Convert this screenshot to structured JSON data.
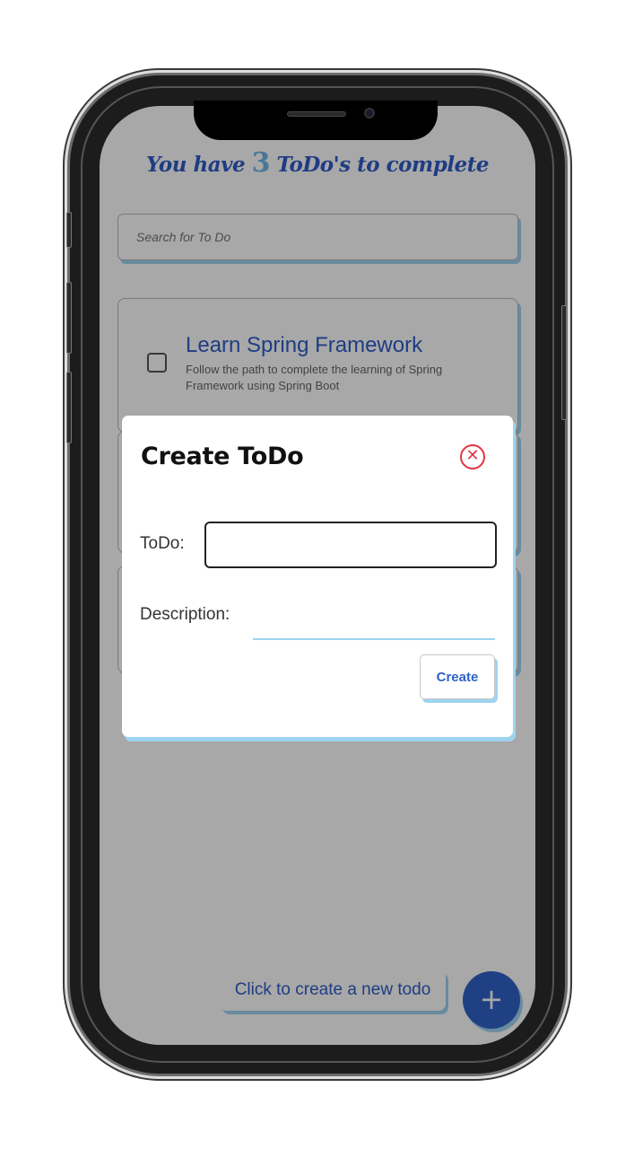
{
  "app": {
    "title_prefix": "You have ",
    "todo_count": "3",
    "title_suffix": " ToDo's to complete",
    "search_placeholder": "Search for To Do"
  },
  "todos": [
    {
      "title": "Learn Spring Framework",
      "description": "Follow the path to complete the learning of Spring Framework using Spring Boot",
      "checked": false
    }
  ],
  "modal": {
    "title": "Create ToDo",
    "close_icon": "close-circle-icon",
    "todo_label": "ToDo:",
    "todo_value": "",
    "description_label": "Description:",
    "description_value": "",
    "create_label": "Create"
  },
  "footer": {
    "hint": "Click to create a new todo",
    "fab_symbol": "+"
  },
  "colors": {
    "accent_blue": "#2f5bc7",
    "light_blue": "#9fd4f0",
    "close_red": "#e03545",
    "overlay": "rgba(0,0,0,0.34)"
  }
}
